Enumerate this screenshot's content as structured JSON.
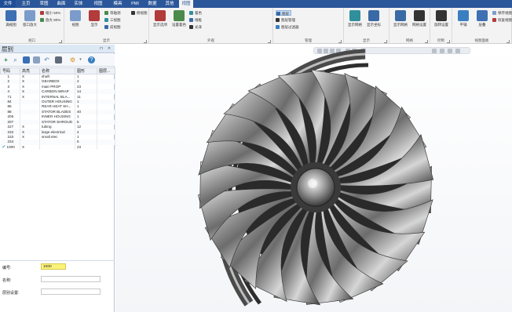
{
  "colors": {
    "ribbon_accent": "#2b579a",
    "selected_field": "#fbf27a",
    "layer_highlight": "#3ca0e0"
  },
  "tabs": [
    "文件",
    "主页",
    "草图",
    "曲面",
    "实体",
    "视图",
    "模具",
    "PMI",
    "数据",
    "其他",
    "视图"
  ],
  "ribbon": {
    "groups": [
      {
        "title": "视口",
        "items": [
          "满视图",
          "窗口放大"
        ],
        "small": [
          "缩小 50%",
          "放大 80%"
        ]
      },
      {
        "title": "显示",
        "items": [
          "视图",
          "显示"
        ],
        "small": [
          "等轴测",
          "三视图",
          "前视图",
          "俯视图"
        ]
      },
      {
        "title": "外观",
        "items": [
          "显示选项",
          "设置着色"
        ],
        "small": [
          "着色",
          "线框",
          "光泽"
        ]
      },
      {
        "title": "管理",
        "items": [],
        "small": [
          "图层",
          "图层管理",
          "图层过滤器"
        ]
      },
      {
        "title": "显示",
        "items": [
          "显示网格",
          "显示坐标"
        ]
      },
      {
        "title": "网格",
        "items": [
          "显示网格",
          "网格设置"
        ]
      },
      {
        "title": "控制",
        "items": [
          "旋转设置"
        ]
      },
      {
        "title": "视图面板",
        "items": [
          "平铺",
          "层叠"
        ],
        "small": [
          "保存视图",
          "恢复视图"
        ]
      }
    ]
  },
  "panel": {
    "title": "层别",
    "columns": [
      "号码",
      "高亮",
      "名称",
      "图形",
      "图层..."
    ],
    "rows": [
      {
        "num": "1",
        "vis": "X",
        "name": "shaft",
        "count": "1"
      },
      {
        "num": "2",
        "vis": "X",
        "name": "GEARBOX",
        "count": "2"
      },
      {
        "num": "3",
        "vis": "X",
        "name": "main PROP",
        "count": "23"
      },
      {
        "num": "4",
        "vis": "X",
        "name": "CARBON WRAP",
        "count": "14"
      },
      {
        "num": "71",
        "vis": "X",
        "name": "INTERNAL BLA...",
        "count": "11"
      },
      {
        "num": "84",
        "vis": "",
        "name": "OUTER HOUSING",
        "count": "1"
      },
      {
        "num": "86",
        "vis": "",
        "name": "REAR HEAT SH...",
        "count": "1"
      },
      {
        "num": "88",
        "vis": "",
        "name": "STATOR BLADES",
        "count": "40"
      },
      {
        "num": "206",
        "vis": "",
        "name": "INNER HOUSING",
        "count": "1"
      },
      {
        "num": "207",
        "vis": "",
        "name": "STATOR SHROUD",
        "count": "5"
      },
      {
        "num": "227",
        "vis": "X",
        "name": "tubing",
        "count": "12"
      },
      {
        "num": "232",
        "vis": "X",
        "name": "large electrical",
        "count": "4"
      },
      {
        "num": "233",
        "vis": "X",
        "name": "small elec",
        "count": "1"
      },
      {
        "num": "234",
        "vis": "",
        "name": "",
        "count": "5"
      },
      {
        "num": "1000",
        "vis": "X",
        "name": "",
        "count": "23"
      }
    ],
    "active_row": 14,
    "props": {
      "number_label": "编号:",
      "number_value": "1000",
      "name_label": "名称:",
      "name_value": "",
      "set_label": "层别设置:",
      "set_value": ""
    }
  }
}
